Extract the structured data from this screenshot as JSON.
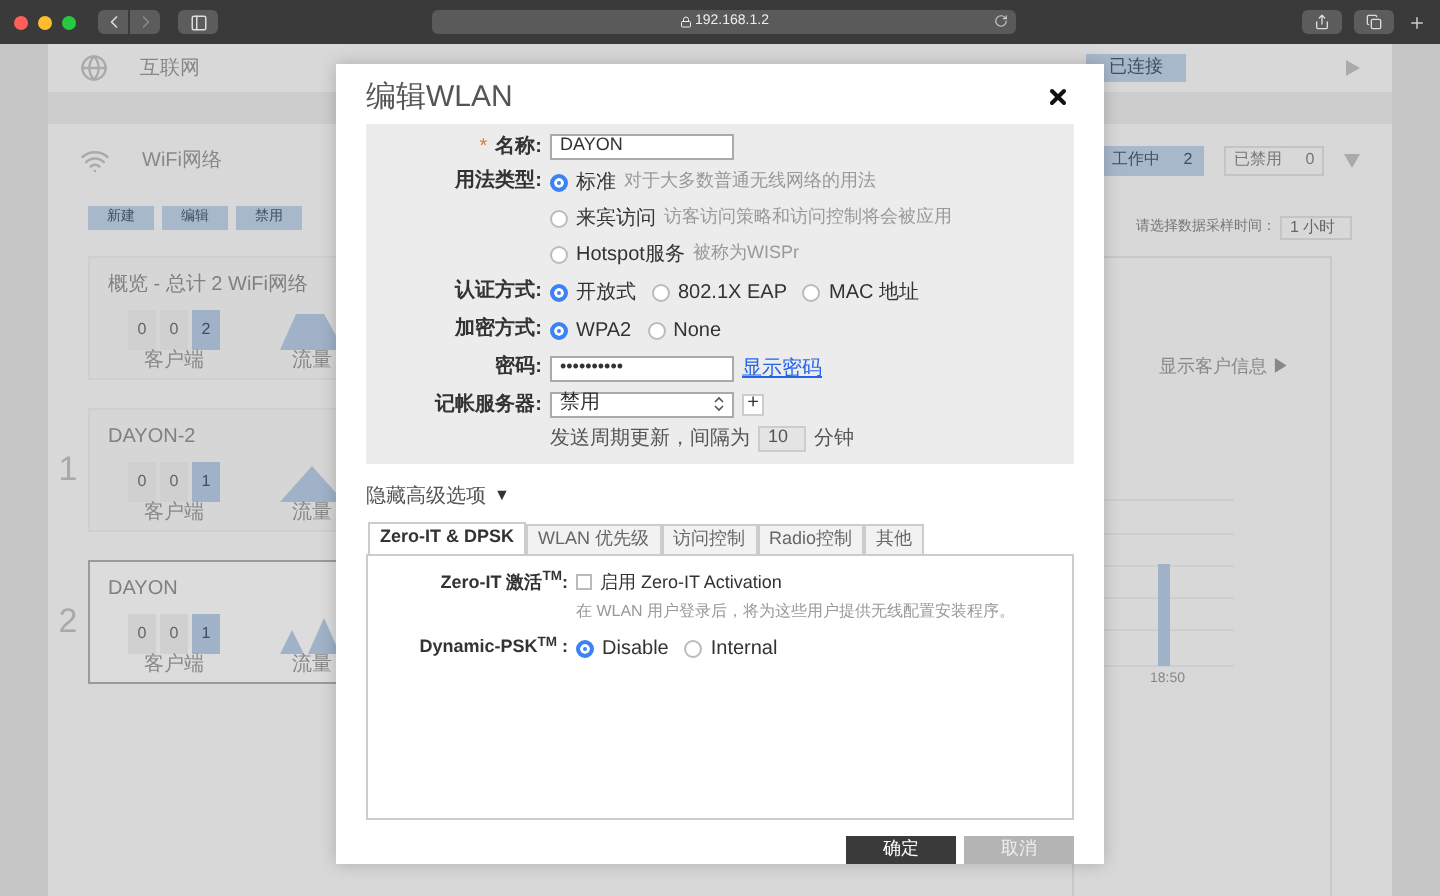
{
  "browser": {
    "address": "192.168.1.2"
  },
  "background": {
    "internet": {
      "title": "互联网",
      "status": "已连接"
    },
    "wifi": {
      "title": "WiFi网络",
      "active": {
        "label": "工作中",
        "count": "2"
      },
      "disabled": {
        "label": "已禁用",
        "count": "0"
      },
      "actions": [
        "新建",
        "编辑",
        "禁用"
      ],
      "sampling": {
        "label": "请选择数据采样时间：",
        "value": "1 小时"
      },
      "cards": [
        {
          "title": "概览 - 总计 2 WiFi网络",
          "counts": [
            "0",
            "0",
            "2"
          ],
          "clients_label": "客户端",
          "traffic_label": "流量",
          "kind": "plateau",
          "selected": false
        },
        {
          "number": "1",
          "title": "DAYON-2",
          "counts": [
            "0",
            "0",
            "1"
          ],
          "clients_label": "客户端",
          "traffic_label": "流量",
          "kind": "peak",
          "selected": false
        },
        {
          "number": "2",
          "title": "DAYON",
          "counts": [
            "0",
            "0",
            "1"
          ],
          "clients_label": "客户端",
          "traffic_label": "流量",
          "kind": "twin",
          "selected": true
        }
      ],
      "client_info_link": "显示客户信息 ▶",
      "chart_time": "18:50"
    }
  },
  "dialog": {
    "title": "编辑WLAN",
    "fields": [
      {
        "kind": "text",
        "required_mark": "*",
        "label": "名称:",
        "value": "DAYON"
      },
      {
        "kind": "radiolist",
        "label": "用法类型:",
        "options": [
          {
            "label": "标准",
            "hint": "对于大多数普通无线网络的用法",
            "selected": true
          },
          {
            "label": "来宾访问",
            "hint": "访客访问策略和访问控制将会被应用",
            "selected": false
          },
          {
            "label": "Hotspot服务",
            "hint": "被称为WISPr",
            "selected": false
          }
        ]
      },
      {
        "kind": "radio",
        "label": "认证方式:",
        "options": [
          {
            "label": "开放式",
            "selected": true
          },
          {
            "label": "802.1X EAP",
            "selected": false
          },
          {
            "label": "MAC 地址",
            "selected": false
          }
        ]
      },
      {
        "kind": "radio",
        "label": "加密方式:",
        "options": [
          {
            "label": "WPA2",
            "selected": true
          },
          {
            "label": "None",
            "selected": false
          }
        ]
      },
      {
        "kind": "password",
        "label": "密码:",
        "value": "••••••••••",
        "link": "显示密码"
      },
      {
        "kind": "select",
        "label": "记帐服务器:",
        "value": "禁用",
        "add": "+",
        "note": {
          "before": "发送周期更新，间隔为",
          "value": "10",
          "after": "分钟"
        }
      }
    ],
    "advanced_toggle": {
      "label": "隐藏高级选项",
      "arrow": "▼"
    },
    "tabs": [
      {
        "label": "Zero-IT & DPSK",
        "selected": true
      },
      {
        "label": "WLAN 优先级",
        "selected": false
      },
      {
        "label": "访问控制",
        "selected": false
      },
      {
        "label": "Radio控制",
        "selected": false
      },
      {
        "label": "其他",
        "selected": false
      }
    ],
    "panel": [
      {
        "kind": "checkbox",
        "label": "Zero-IT 激活$^{TM}$:",
        "option": "启用 Zero-IT Activation",
        "checked": false,
        "note": "在 WLAN 用户登录后，将为这些用户提供无线配置安装程序。"
      },
      {
        "kind": "radio",
        "label": "Dynamic-PSK$^{TM}$ :",
        "options": [
          {
            "label": "Disable",
            "selected": true
          },
          {
            "label": "Internal",
            "selected": false
          }
        ]
      }
    ],
    "buttons": [
      {
        "label": "确定",
        "kind": "primary"
      },
      {
        "label": "取消",
        "kind": "secondary"
      }
    ]
  }
}
